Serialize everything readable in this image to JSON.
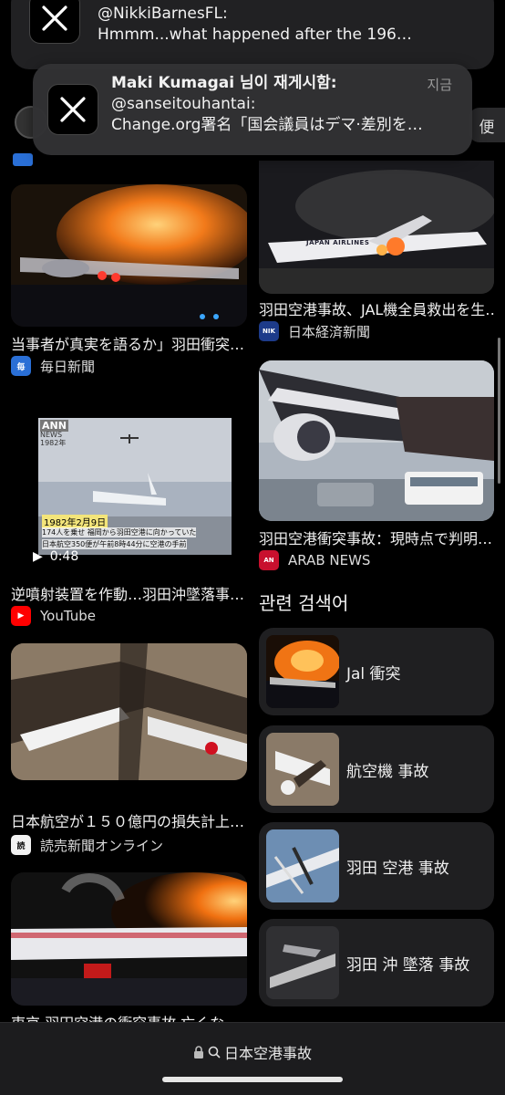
{
  "notifications": {
    "back": {
      "handle": "@NikkiBarnesFL:",
      "text": "Hmmm...what happened after the 196…"
    },
    "front": {
      "title": "Maki Kumagai 님이 재게시함:",
      "time": "지금",
      "handle": "@sanseitouhantai:",
      "text": "Change.org署名「国会議員はデマ·差別を…"
    },
    "side_tab_label": "便"
  },
  "results_left": [
    {
      "caption": "当事者が真実を語るか」羽田衝突…",
      "source": "毎日新聞",
      "source_icon": "mainichi-icon"
    },
    {
      "caption": "逆噴射装置を作動…羽田沖墜落事…",
      "source": "YouTube",
      "source_icon": "youtube-icon",
      "video_duration": "0:48"
    },
    {
      "caption": "日本航空が１５０億円の損失計上…",
      "source": "読売新聞オンライン",
      "source_icon": "yomiuri-icon"
    },
    {
      "caption": "東京·羽田空港の衝突事故 亡くな…",
      "source": "",
      "source_icon": ""
    }
  ],
  "results_right": [
    {
      "caption": "羽田空港事故、JAL機全員救出を生…",
      "source": "日本経済新聞",
      "source_icon": "nikkei-icon",
      "thumb_text": "JAPAN AIRLINES"
    },
    {
      "caption": "羽田空港衝突事故：現時点で判明…",
      "source": "ARAB NEWS",
      "source_icon": "arabnews-icon"
    }
  ],
  "video_overlay": {
    "logo": "ANN",
    "sub": "NEWS",
    "year": "1982年",
    "date": "1982年2月9日",
    "subtitle1": "174人を乗せ 福岡から羽田空港に向かっていた",
    "subtitle2": "日本航空350便が午前8時44分に空港の手前"
  },
  "related": {
    "title": "관련 검색어",
    "items": [
      {
        "label": "Jal 衝突"
      },
      {
        "label": "航空機 事故"
      },
      {
        "label": "羽田 空港 事故"
      },
      {
        "label": "羽田 沖 墜落 事故"
      }
    ]
  },
  "address_bar": {
    "query": "日本空港事故"
  },
  "colors": {
    "background": "#000000",
    "card": "#1f1f21",
    "notification": "#323234",
    "youtube_red": "#ff0000",
    "arab_news_red": "#c8102e"
  }
}
